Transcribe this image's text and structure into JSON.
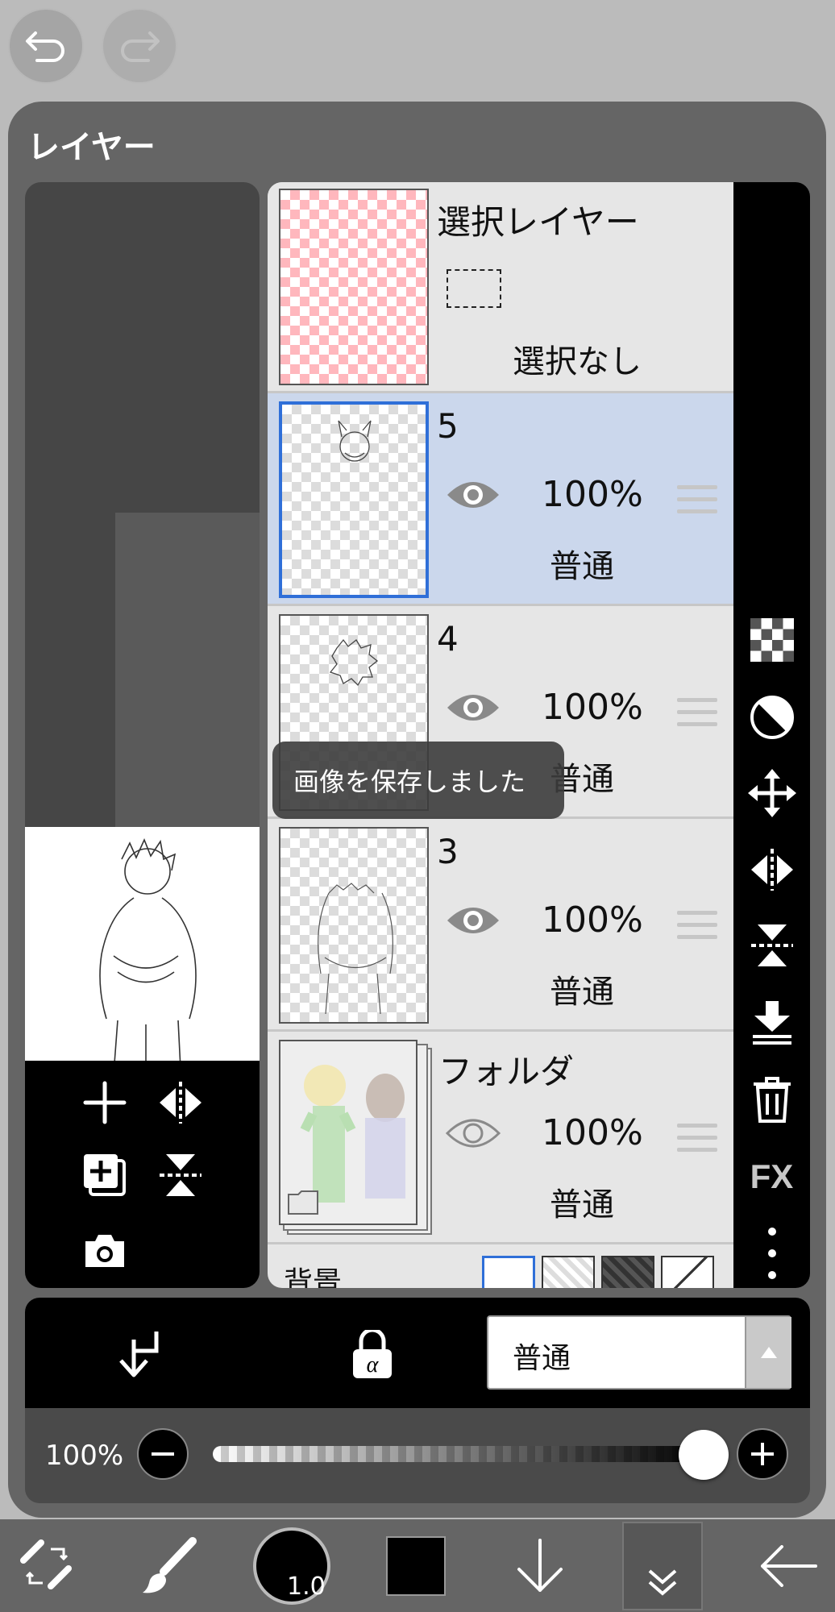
{
  "panel": {
    "title": "レイヤー"
  },
  "selection_layer": {
    "name": "選択レイヤー",
    "status": "選択なし"
  },
  "layers": [
    {
      "name": "5",
      "opacity": "100%",
      "blend": "普通",
      "selected": true,
      "visible": true
    },
    {
      "name": "4",
      "opacity": "100%",
      "blend": "普通",
      "selected": false,
      "visible": true
    },
    {
      "name": "3",
      "opacity": "100%",
      "blend": "普通",
      "selected": false,
      "visible": true
    },
    {
      "name": "フォルダ",
      "opacity": "100%",
      "blend": "普通",
      "selected": false,
      "visible": false,
      "is_folder": true
    }
  ],
  "background_row": {
    "label": "背景"
  },
  "toast": {
    "message": "画像を保存しました"
  },
  "blend_mode": {
    "value": "普通"
  },
  "opacity": {
    "label": "100%",
    "value": 1.0
  },
  "brush_size": {
    "value": "1.0"
  },
  "colors": {
    "accent": "#2f6fd8",
    "selected_row": "#cbd7ec"
  },
  "icons": {
    "undo": "undo-icon",
    "redo": "redo-icon",
    "add_layer": "plus-icon",
    "flip_h": "flip-horizontal-icon",
    "duplicate": "duplicate-layer-icon",
    "flip_v": "flip-vertical-icon",
    "camera": "camera-icon",
    "transparency": "checker-icon",
    "mask": "half-circle-icon",
    "move": "move-icon",
    "merge_down": "merge-down-icon",
    "delete": "trash-icon",
    "fx": "fx-icon",
    "more": "more-icon",
    "clip": "clipping-arrow-icon",
    "alpha_lock": "alpha-lock-icon"
  }
}
